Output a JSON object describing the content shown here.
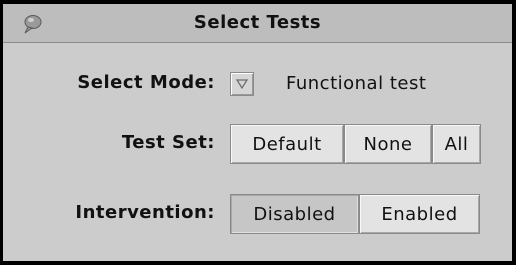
{
  "dialog": {
    "title": "Select Tests",
    "icon": "balloon-icon"
  },
  "select_mode": {
    "label": "Select Mode:",
    "value": "Functional test",
    "dropdown_icon": "triangle-down-icon"
  },
  "test_set": {
    "label": "Test Set:",
    "options": [
      "Default",
      "None",
      "All"
    ]
  },
  "intervention": {
    "label": "Intervention:",
    "options": [
      "Disabled",
      "Enabled"
    ],
    "selected": "Disabled"
  },
  "colors": {
    "panel": "#cccccc",
    "titlebar": "#bdbdbd",
    "button": "#e3e3e3",
    "button_selected": "#c6c6c6",
    "border": "#000000"
  }
}
